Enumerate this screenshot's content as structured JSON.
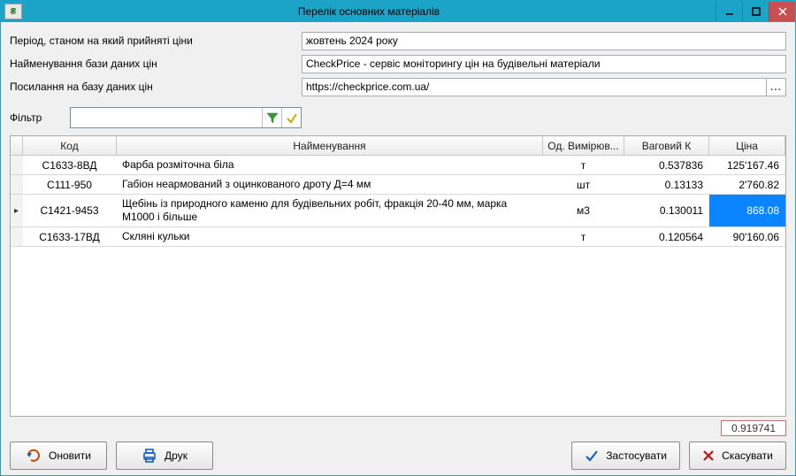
{
  "window": {
    "title": "Перелік основних матеріалів",
    "icon_text": "₴"
  },
  "form": {
    "period_label": "Період, станом на який прийняті ціни",
    "period_value": "жовтень 2024 року",
    "dbname_label": "Найменування бази даних цін",
    "dbname_value": "CheckPrice - сервіс моніторингу цін на будівельні матеріали",
    "link_label": "Посилання на базу даних цін",
    "link_value": "https://checkprice.com.ua/",
    "link_more": "..."
  },
  "filter": {
    "label": "Фільтр",
    "value": ""
  },
  "grid": {
    "headers": {
      "code": "Код",
      "name": "Найменування",
      "unit": "Од. Вимірюв...",
      "weight": "Ваговий К",
      "price": "Ціна"
    },
    "rows": [
      {
        "code": "С1633-8ВД",
        "name": "Фарба розміточна біла",
        "unit": "т",
        "weight": "0.537836",
        "price": "125'167.46",
        "selected": false
      },
      {
        "code": "С111-950",
        "name": "Габіон неармований з оцинкованого дроту Д=4 мм",
        "unit": "шт",
        "weight": "0.13133",
        "price": "2'760.82",
        "selected": false
      },
      {
        "code": "С1421-9453",
        "name": "Щебінь із природного каменю для будівельних робіт, фракція 20-40 мм, марка М1000 і більше",
        "unit": "м3",
        "weight": "0.130011",
        "price": "868.08",
        "selected": true
      },
      {
        "code": "С1633-17ВД",
        "name": "Скляні кульки",
        "unit": "т",
        "weight": "0.120564",
        "price": "90'160.06",
        "selected": false
      }
    ]
  },
  "footer": {
    "total": "0.919741"
  },
  "buttons": {
    "refresh": "Оновити",
    "print": "Друк",
    "apply": "Застосувати",
    "cancel": "Скасувати"
  }
}
